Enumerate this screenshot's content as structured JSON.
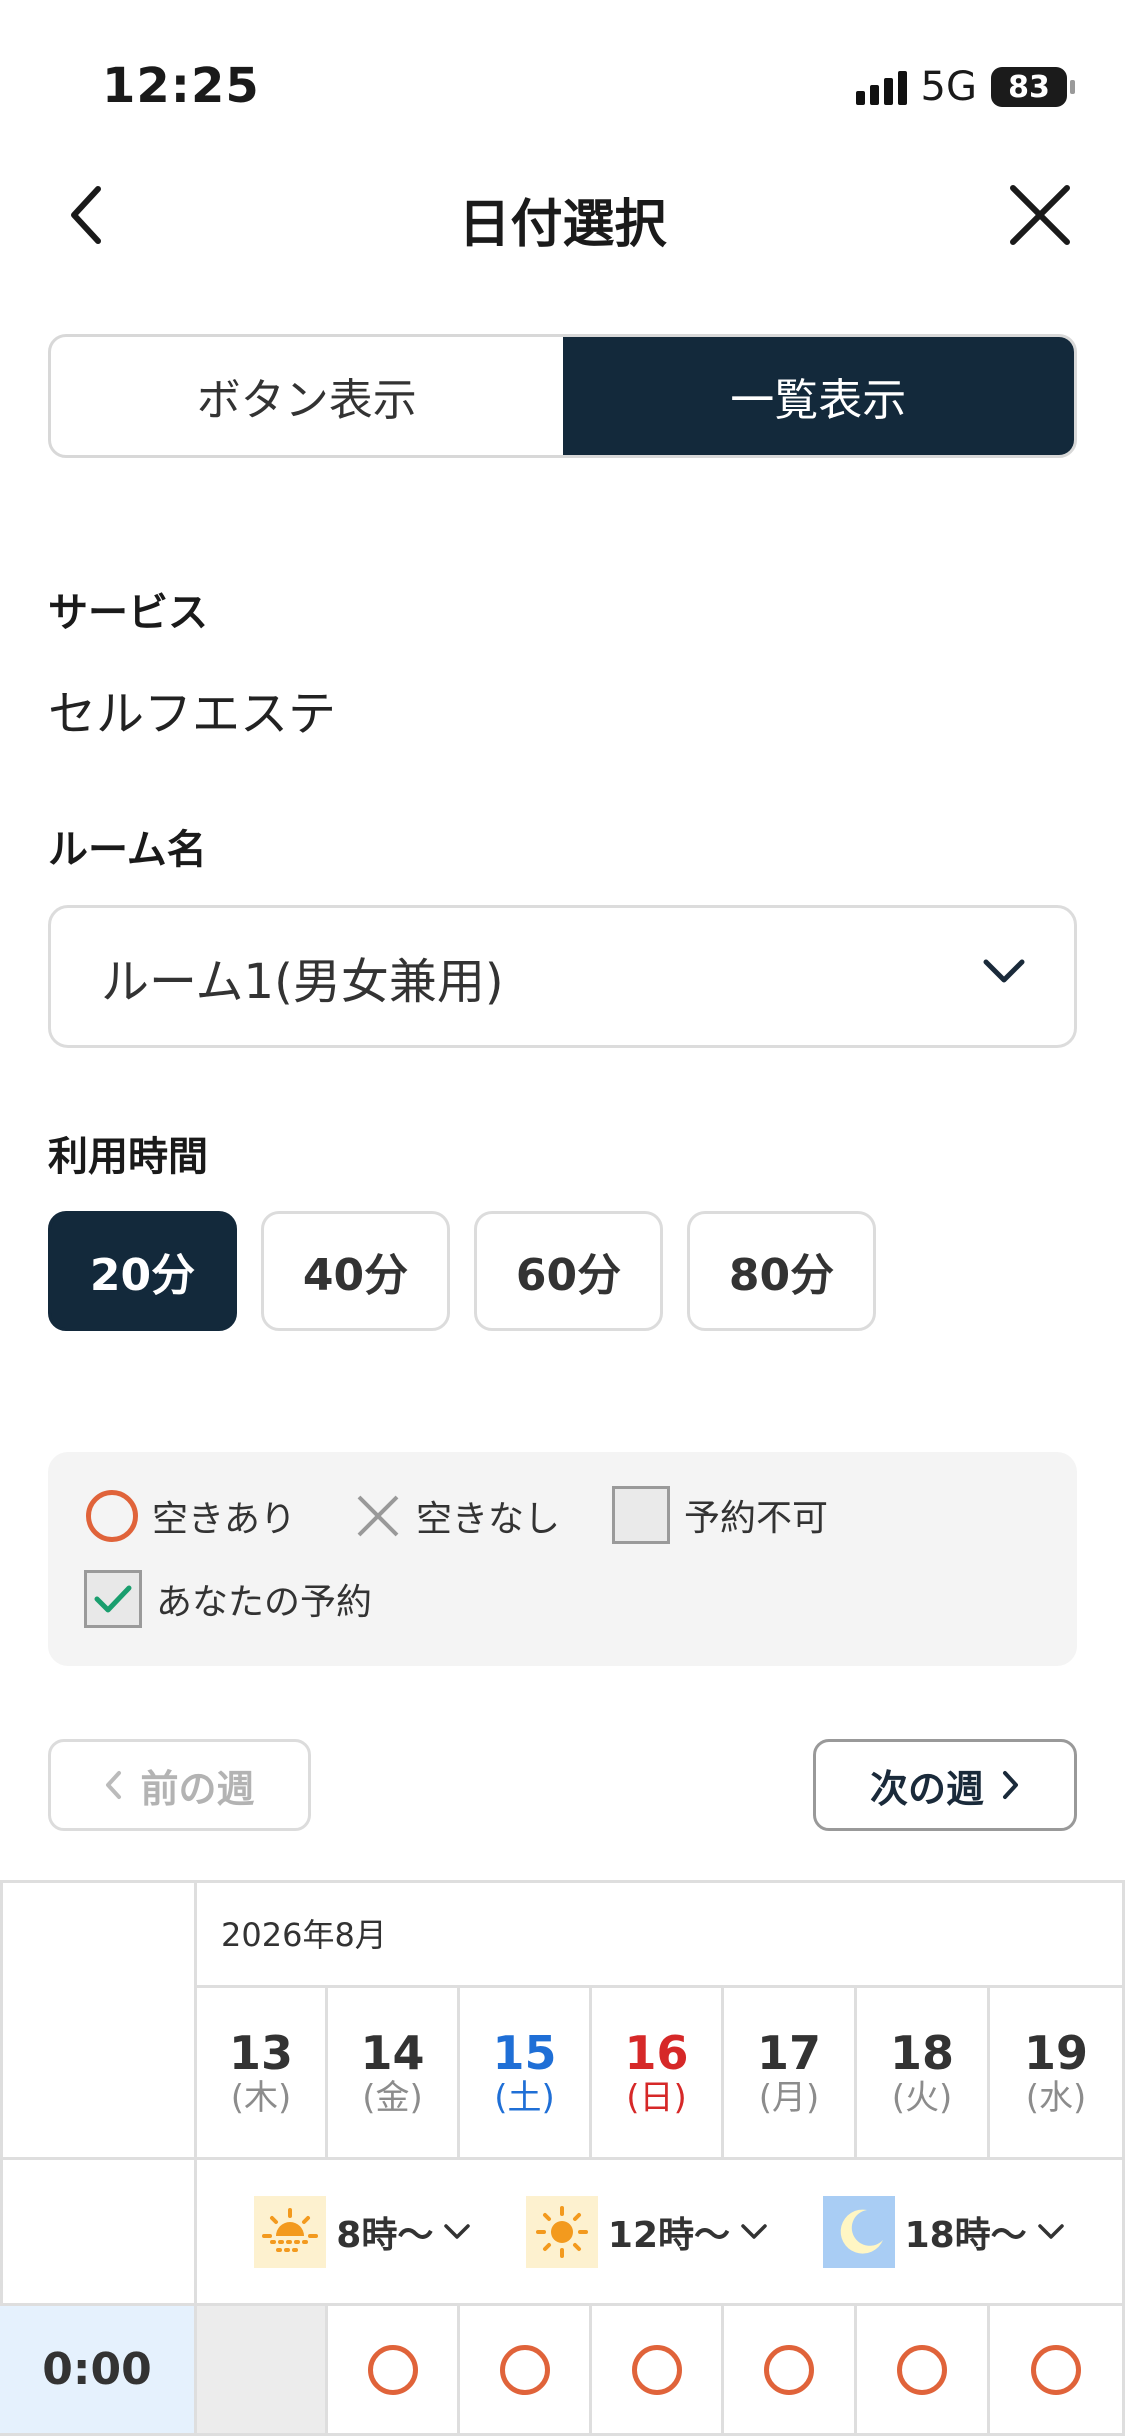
{
  "status_bar": {
    "time": "12:25",
    "network": "5G",
    "battery": "83"
  },
  "header": {
    "title": "日付選択"
  },
  "view_toggle": {
    "options": [
      "ボタン表示",
      "一覧表示"
    ],
    "selected": "一覧表示"
  },
  "service": {
    "label": "サービス",
    "value": "セルフエステ"
  },
  "room": {
    "label": "ルーム名",
    "selected": "ルーム1(男女兼用)"
  },
  "duration": {
    "label": "利用時間",
    "options": [
      "20分",
      "40分",
      "60分",
      "80分"
    ],
    "selected": "20分"
  },
  "legend": {
    "available": "空きあり",
    "full": "空きなし",
    "unavailable": "予約不可",
    "mine": "あなたの予約"
  },
  "week_nav": {
    "prev": "前の週",
    "next": "次の週",
    "prev_enabled": false
  },
  "calendar": {
    "month": "2026年8月",
    "days": [
      {
        "num": "13",
        "weekday": "(木)",
        "type": "weekday"
      },
      {
        "num": "14",
        "weekday": "(金)",
        "type": "weekday"
      },
      {
        "num": "15",
        "weekday": "(土)",
        "type": "sat"
      },
      {
        "num": "16",
        "weekday": "(日)",
        "type": "sun"
      },
      {
        "num": "17",
        "weekday": "(月)",
        "type": "weekday"
      },
      {
        "num": "18",
        "weekday": "(火)",
        "type": "weekday"
      },
      {
        "num": "19",
        "weekday": "(水)",
        "type": "weekday"
      }
    ],
    "time_of_day": [
      {
        "label": "8時〜",
        "icon": "sunrise-icon"
      },
      {
        "label": "12時〜",
        "icon": "sun-icon"
      },
      {
        "label": "18時〜",
        "icon": "moon-icon"
      }
    ],
    "rows": [
      {
        "time": "0:00",
        "slots": [
          "unavailable",
          "available",
          "available",
          "available",
          "available",
          "available",
          "available"
        ]
      }
    ]
  },
  "colors": {
    "primary": "#13293b",
    "available": "#e0633a",
    "saturday": "#1f6fd6",
    "sunday": "#d62828",
    "check": "#1a9e6e"
  }
}
